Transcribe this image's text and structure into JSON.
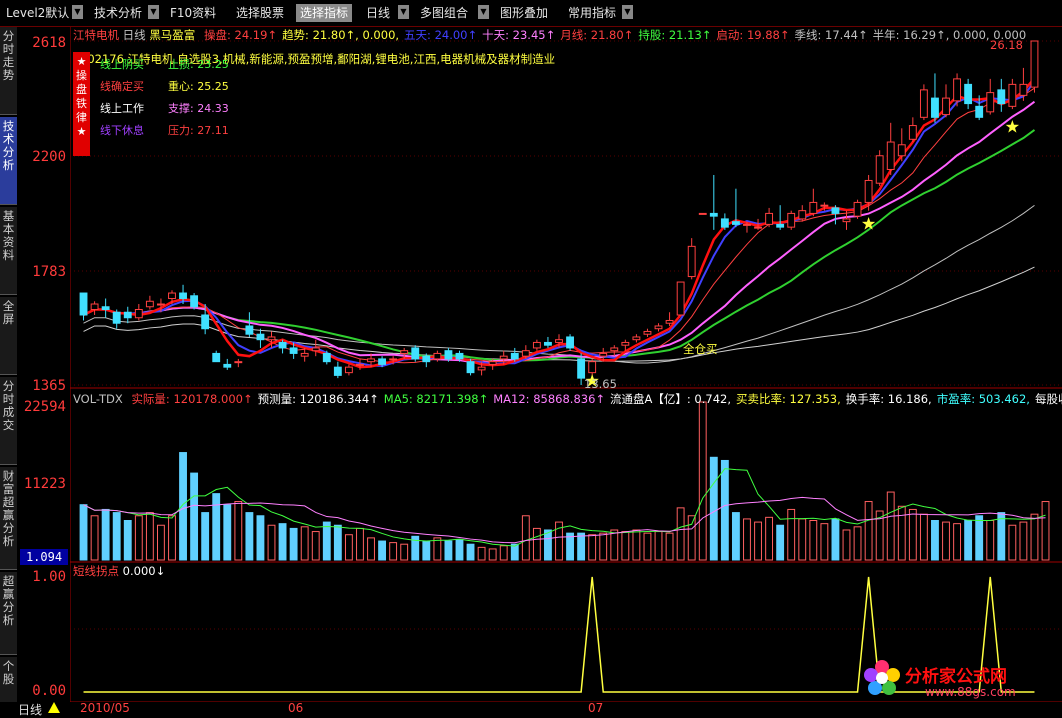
{
  "toolbar": {
    "items": [
      {
        "label": "Level2默认",
        "arrow": true
      },
      {
        "label": "技术分析",
        "arrow": true
      },
      {
        "label": "F10资料",
        "arrow": false
      },
      {
        "label": "选择股票",
        "arrow": false
      },
      {
        "label": "选择指标",
        "arrow": false
      },
      {
        "label": "日线",
        "arrow": true
      },
      {
        "label": "多图组合",
        "arrow": true
      },
      {
        "label": "图形叠加",
        "arrow": false
      },
      {
        "label": "常用指标",
        "arrow": true
      }
    ]
  },
  "left_tabs": [
    "分时走势",
    "技术分析",
    "基本资料",
    "全屏",
    "分时成交",
    "财富超赢分析",
    "超赢分析",
    "个股"
  ],
  "price_axis": {
    "labels": [
      "2618",
      "2200",
      "1783",
      "1365"
    ]
  },
  "volume_axis": {
    "labels": [
      "22594",
      "11223"
    ],
    "box": "1.094"
  },
  "indicator_axis": {
    "labels": [
      "1.00",
      "0.00"
    ]
  },
  "main_header": {
    "stock": "江特电机",
    "period": "日线",
    "indicator": "黑马盈富",
    "items": [
      {
        "name": "操盘",
        "value": "24.19↑",
        "color": "#ff4040"
      },
      {
        "name": "趋势",
        "value": "21.80↑, 0.000,",
        "color": "#ffff40"
      },
      {
        "name": "五天",
        "value": "24.00↑",
        "color": "#4040ff"
      },
      {
        "name": "十天",
        "value": "23.45↑",
        "color": "#ff80ff"
      },
      {
        "name": "月线",
        "value": "21.80↑",
        "color": "#ff4040"
      },
      {
        "name": "持股",
        "value": "21.13↑",
        "color": "#40ff40"
      },
      {
        "name": "启动",
        "value": "19.88↑",
        "color": "#ff4040"
      },
      {
        "name": "季线",
        "value": "17.44↑",
        "color": "#c0c0c0"
      },
      {
        "name": "半年",
        "value": "16.29↑, 0.000, 0.000",
        "color": "#c0c0c0"
      }
    ]
  },
  "stock_info": "002176 江特电机 自选股3,机械,新能源,预盈预增,鄱阳湖,锂电池,江西,电器机械及器材制造业",
  "rule_box": {
    "side_title": "操盘铁律",
    "rows": [
      {
        "left": "线上阴买",
        "left_color": "#40ff40",
        "right": "止损: 23.25",
        "right_color": "#40ff40"
      },
      {
        "left": "线确定买",
        "left_color": "#ff4040",
        "right": "重心: 25.25",
        "right_color": "#ffff40"
      },
      {
        "left": "线上工作",
        "left_color": "#ffffff",
        "right": "支撑: 24.33",
        "right_color": "#ff80ff"
      },
      {
        "left": "线下休息",
        "left_color": "#a040ff",
        "right": "压力: 27.11",
        "right_color": "#ff4040"
      }
    ]
  },
  "price_labels": {
    "high": "26.18",
    "low": "13.65",
    "signal": "全仓买"
  },
  "volume_header": {
    "name": "VOL-TDX",
    "items": [
      {
        "text": "实际量: 120178.000↑",
        "color": "#ff4040"
      },
      {
        "text": "预测量: 120186.344↑",
        "color": "#ffffff"
      },
      {
        "text": "MA5: 82171.398↑",
        "color": "#40ff40"
      },
      {
        "text": "MA12: 85868.836↑",
        "color": "#ff80ff"
      },
      {
        "text": "流通盘A【亿】: 0.742,",
        "color": "#ffffff"
      },
      {
        "text": "买卖比率: 127.353,",
        "color": "#ffff40"
      },
      {
        "text": "换手率: 16.186,",
        "color": "#ffffff"
      },
      {
        "text": "市盈率: 503.462,",
        "color": "#40ffff"
      },
      {
        "text": "每股收益",
        "color": "#ffffff"
      }
    ]
  },
  "indicator_header": {
    "name": "短线拐点",
    "value": "0.000↓"
  },
  "bottom": {
    "period": "日线",
    "dates": [
      "2010/05",
      "06",
      "07"
    ]
  },
  "watermark": {
    "text": "分析家公式网",
    "url": "www.88gs.com"
  },
  "chart_data": {
    "type": "candlestick",
    "price_axis": {
      "ticks": [
        26.18,
        22.0,
        17.83,
        13.65
      ]
    },
    "candles": [
      [
        17,
        16.2,
        16.2,
        16.0
      ],
      [
        16.4,
        16.6,
        16.2,
        16.7
      ],
      [
        16.5,
        16.4,
        16.1,
        16.8
      ],
      [
        16.3,
        15.9,
        15.7,
        16.4
      ],
      [
        16.3,
        16.1,
        15.9,
        16.5
      ],
      [
        16.1,
        16.4,
        16.0,
        16.6
      ],
      [
        16.5,
        16.7,
        16.4,
        16.9
      ],
      [
        16.6,
        16.6,
        16.3,
        16.8
      ],
      [
        16.8,
        17.0,
        16.6,
        17.1
      ],
      [
        17.0,
        16.8,
        16.6,
        17.3
      ],
      [
        16.9,
        16.5,
        16.4,
        17.0
      ],
      [
        16.2,
        15.7,
        15.5,
        16.6
      ],
      [
        14.8,
        14.5,
        14.5,
        14.9
      ],
      [
        14.4,
        14.3,
        14.2,
        14.6
      ],
      [
        14.5,
        14.5,
        14.3,
        14.6
      ],
      [
        15.8,
        15.5,
        15.4,
        16.3
      ],
      [
        15.5,
        15.3,
        15.0,
        15.7
      ],
      [
        15.3,
        15.4,
        15.0,
        15.6
      ],
      [
        15.2,
        15.0,
        14.8,
        15.3
      ],
      [
        15.0,
        14.8,
        14.6,
        15.2
      ],
      [
        14.7,
        14.8,
        14.5,
        15.0
      ],
      [
        14.9,
        15.0,
        14.7,
        15.3
      ],
      [
        14.8,
        14.5,
        14.4,
        14.9
      ],
      [
        14.3,
        14.0,
        13.9,
        14.5
      ],
      [
        14.1,
        14.3,
        14.0,
        14.4
      ],
      [
        14.4,
        14.4,
        14.2,
        14.6
      ],
      [
        14.5,
        14.6,
        14.3,
        14.8
      ],
      [
        14.6,
        14.4,
        14.3,
        14.7
      ],
      [
        14.6,
        14.6,
        14.4,
        14.7
      ],
      [
        14.8,
        14.9,
        14.6,
        15.0
      ],
      [
        15.0,
        14.6,
        14.5,
        15.1
      ],
      [
        14.7,
        14.5,
        14.3,
        14.8
      ],
      [
        14.6,
        14.8,
        14.5,
        14.9
      ],
      [
        14.9,
        14.6,
        14.5,
        15.0
      ],
      [
        14.8,
        14.6,
        14.5,
        14.9
      ],
      [
        14.5,
        14.1,
        14.0,
        14.6
      ],
      [
        14.2,
        14.3,
        14.0,
        14.5
      ],
      [
        14.4,
        14.5,
        14.2,
        14.6
      ],
      [
        14.6,
        14.7,
        14.4,
        14.9
      ],
      [
        14.8,
        14.6,
        14.5,
        15.0
      ],
      [
        14.7,
        14.9,
        14.6,
        15.1
      ],
      [
        15.0,
        15.2,
        14.9,
        15.3
      ],
      [
        15.2,
        15.1,
        15.0,
        15.4
      ],
      [
        15.2,
        15.3,
        15.0,
        15.5
      ],
      [
        15.4,
        15.0,
        14.9,
        15.5
      ],
      [
        14.6,
        13.9,
        13.65,
        14.8
      ],
      [
        14.1,
        14.5,
        14.0,
        14.6
      ],
      [
        14.7,
        14.8,
        14.5,
        15.0
      ],
      [
        14.9,
        15.0,
        14.7,
        15.1
      ],
      [
        15.1,
        15.2,
        14.9,
        15.3
      ],
      [
        15.3,
        15.4,
        15.2,
        15.5
      ],
      [
        15.5,
        15.6,
        15.4,
        15.7
      ],
      [
        15.7,
        15.8,
        15.6,
        15.9
      ],
      [
        15.9,
        16.0,
        15.8,
        16.3
      ],
      [
        16.2,
        17.4,
        16.2,
        17.4
      ],
      [
        17.6,
        18.7,
        17.5,
        19.0
      ],
      [
        19.9,
        19.9,
        19.9,
        19.9
      ],
      [
        19.9,
        19.8,
        19.3,
        21.3
      ],
      [
        19.7,
        19.4,
        19.3,
        19.9
      ],
      [
        19.6,
        19.5,
        19.4,
        20.8
      ],
      [
        19.5,
        19.5,
        19.2,
        19.6
      ],
      [
        19.4,
        19.4,
        19.3,
        19.7
      ],
      [
        19.5,
        19.9,
        19.4,
        20.1
      ],
      [
        19.5,
        19.4,
        19.3,
        20.2
      ],
      [
        19.4,
        19.9,
        19.3,
        20.0
      ],
      [
        19.7,
        20.0,
        19.6,
        20.2
      ],
      [
        19.9,
        20.3,
        19.8,
        20.8
      ],
      [
        20.2,
        20.2,
        20.0,
        20.3
      ],
      [
        20.1,
        19.9,
        19.5,
        20.2
      ],
      [
        19.6,
        19.7,
        19.3,
        20.0
      ],
      [
        19.8,
        20.3,
        19.7,
        20.4
      ],
      [
        20.3,
        21.1,
        20.0,
        21.3
      ],
      [
        21.0,
        22.0,
        20.9,
        22.2
      ],
      [
        21.5,
        22.5,
        21.3,
        23.2
      ],
      [
        22.0,
        22.4,
        21.8,
        23.0
      ],
      [
        22.6,
        23.1,
        22.5,
        23.4
      ],
      [
        23.4,
        24.4,
        23.3,
        24.6
      ],
      [
        24.1,
        23.4,
        23.2,
        25.0
      ],
      [
        23.5,
        24.1,
        23.4,
        24.6
      ],
      [
        24.0,
        24.8,
        23.8,
        25.0
      ],
      [
        24.6,
        23.9,
        23.7,
        24.8
      ],
      [
        23.8,
        23.4,
        23.3,
        24.2
      ],
      [
        23.6,
        24.3,
        23.5,
        24.8
      ],
      [
        24.4,
        23.9,
        23.6,
        24.8
      ],
      [
        23.8,
        24.6,
        23.7,
        24.8
      ],
      [
        24.2,
        24.6,
        24.0,
        25.2
      ],
      [
        24.5,
        26.18,
        24.3,
        26.18
      ]
    ],
    "volume": [
      0.35,
      0.28,
      0.32,
      0.3,
      0.25,
      0.28,
      0.3,
      0.22,
      0.28,
      0.68,
      0.55,
      0.3,
      0.42,
      0.35,
      0.37,
      0.3,
      0.28,
      0.22,
      0.23,
      0.2,
      0.21,
      0.18,
      0.24,
      0.22,
      0.16,
      0.2,
      0.14,
      0.12,
      0.11,
      0.1,
      0.15,
      0.12,
      0.14,
      0.12,
      0.13,
      0.1,
      0.08,
      0.07,
      0.09,
      0.1,
      0.28,
      0.2,
      0.19,
      0.24,
      0.17,
      0.17,
      0.16,
      0.17,
      0.19,
      0.18,
      0.19,
      0.17,
      0.18,
      0.17,
      0.33,
      0.28,
      1.0,
      0.65,
      0.63,
      0.3,
      0.26,
      0.24,
      0.27,
      0.22,
      0.32,
      0.26,
      0.25,
      0.23,
      0.26,
      0.19,
      0.21,
      0.37,
      0.31,
      0.43,
      0.34,
      0.32,
      0.29,
      0.25,
      0.24,
      0.23,
      0.25,
      0.28,
      0.25,
      0.3,
      0.22,
      0.24,
      0.29,
      0.37
    ],
    "indicator_spikes": [
      46,
      71,
      82
    ]
  }
}
